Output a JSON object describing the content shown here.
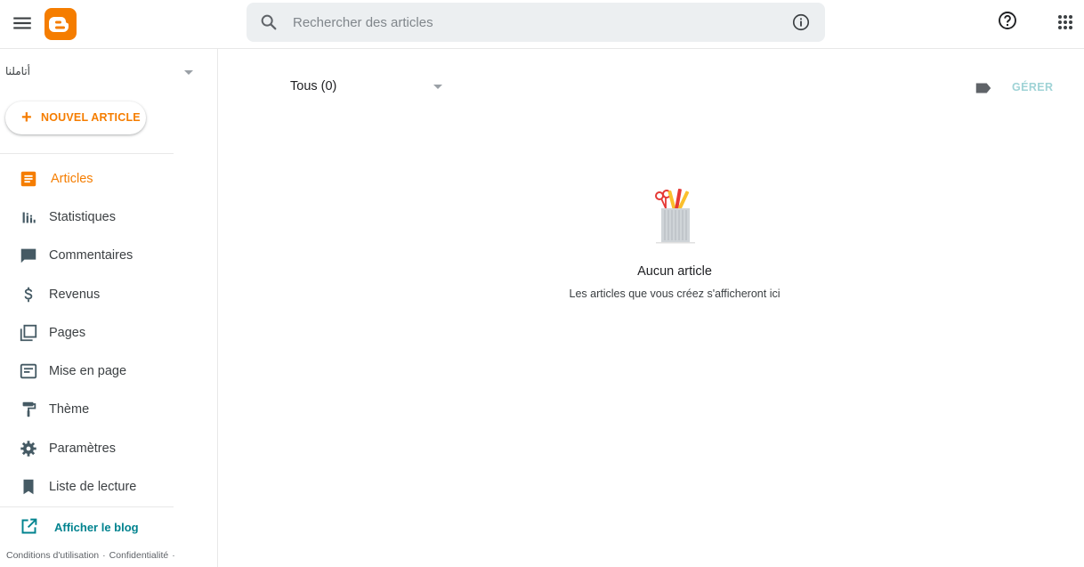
{
  "header": {
    "search_placeholder": "Rechercher des articles"
  },
  "sidebar": {
    "blog_name": "أتاملنا",
    "new_post_label": "NOUVEL ARTICLE",
    "items": [
      {
        "label": "Articles",
        "icon": "posts-icon",
        "active": true
      },
      {
        "label": "Statistiques",
        "icon": "stats-icon"
      },
      {
        "label": "Commentaires",
        "icon": "comment-icon"
      },
      {
        "label": "Revenus",
        "icon": "dollar-icon"
      },
      {
        "label": "Pages",
        "icon": "pages-icon"
      },
      {
        "label": "Mise en page",
        "icon": "layout-icon"
      },
      {
        "label": "Thème",
        "icon": "paint-roller-icon"
      },
      {
        "label": "Paramètres",
        "icon": "gear-icon"
      },
      {
        "label": "Liste de lecture",
        "icon": "bookmark-icon"
      }
    ],
    "view_blog_label": "Afficher le blog",
    "footer": {
      "terms": "Conditions d'utilisation",
      "privacy": "Confidentialité",
      "separator": "·"
    }
  },
  "main": {
    "filter_label": "Tous (0)",
    "manage_label": "GÉRER",
    "empty_title": "Aucun article",
    "empty_subtitle": "Les articles que vous créez s'afficheront ici"
  },
  "colors": {
    "brand": "#f57d00",
    "link": "#00838f",
    "manage_disabled": "#9fd3d6",
    "icon": "#546e7a"
  }
}
